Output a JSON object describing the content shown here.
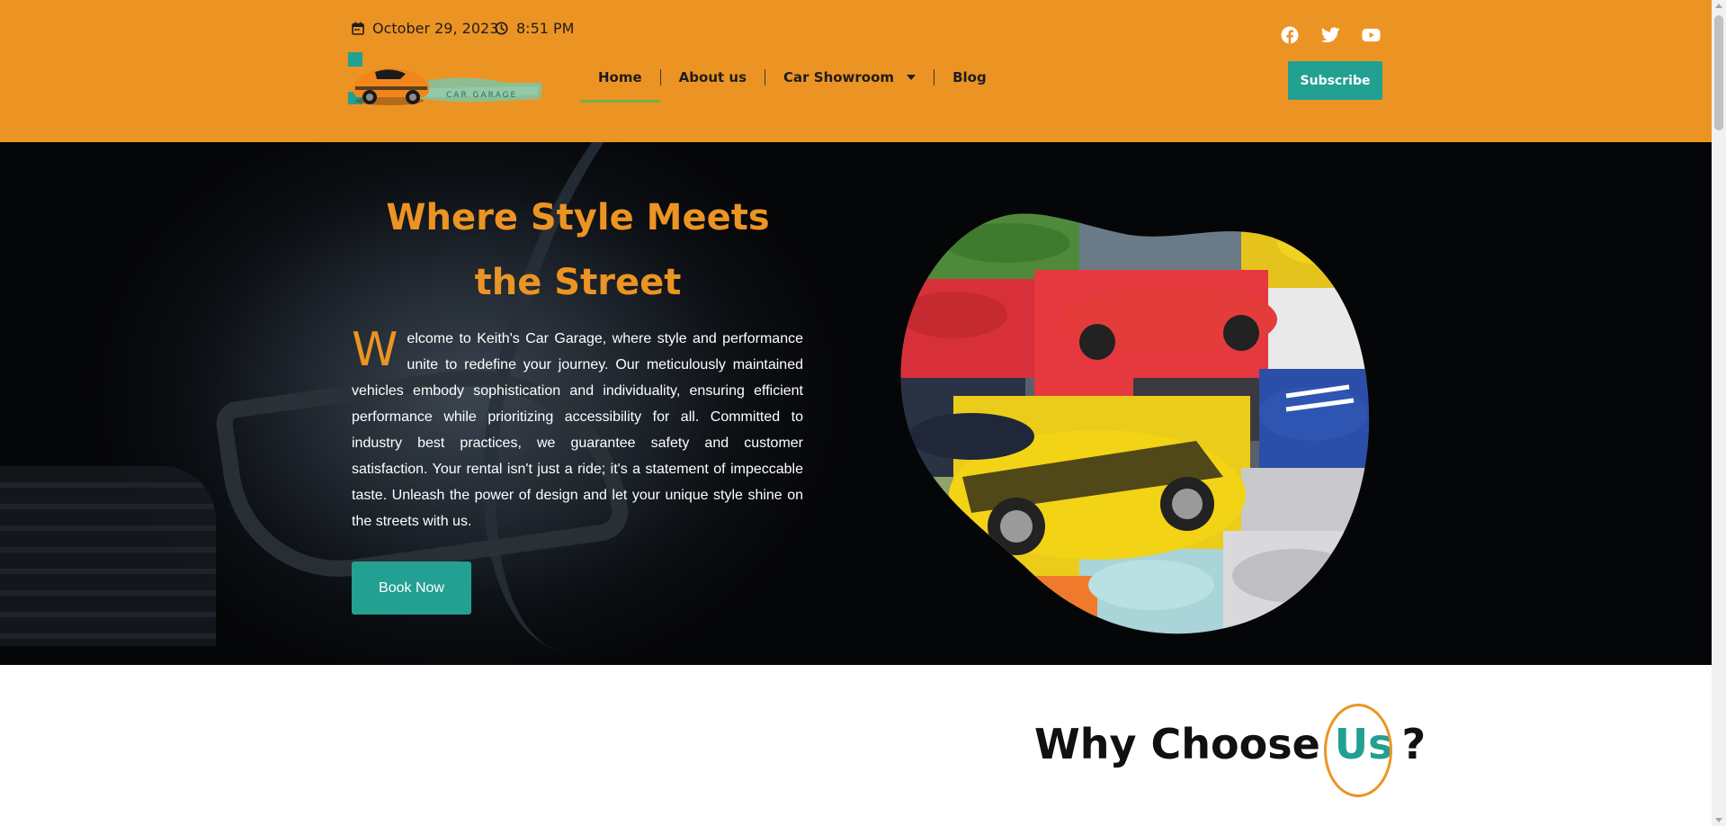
{
  "topbar": {
    "date": "October 29, 2023",
    "time": "8:51 PM",
    "date_icon": "calendar-icon",
    "time_icon": "clock-icon"
  },
  "logo": {
    "text": "CAR GARAGE"
  },
  "nav": {
    "items": [
      {
        "label": "Home",
        "active": true
      },
      {
        "label": "About us"
      },
      {
        "label": "Car Showroom",
        "has_dropdown": true
      },
      {
        "label": "Blog"
      }
    ]
  },
  "social": {
    "icons": [
      "facebook-icon",
      "twitter-icon",
      "youtube-icon"
    ]
  },
  "subscribe_label": "Subscribe",
  "hero": {
    "title": "Where Style Meets the Street",
    "dropcap": "W",
    "body": "elcome to Keith's Car Garage, where style and performance unite to redefine your journey. Our meticulously maintained vehicles embody sophistication and individuality, ensuring efficient performance while prioritizing accessibility for all. Committed to industry best practices, we guarantee safety and customer satisfaction. Your rental isn't just a ride; it's a statement of impeccable taste. Unleash the power of design and let your unique style shine on the streets with us.",
    "button_label": "Book Now"
  },
  "why": {
    "prefix": "Why Choose",
    "highlight": "Us",
    "suffix": "?"
  },
  "colors": {
    "header_bg": "#ec9423",
    "accent_teal": "#22a092",
    "title_orange": "#ec9423",
    "nav_underline": "#6fb14a"
  }
}
